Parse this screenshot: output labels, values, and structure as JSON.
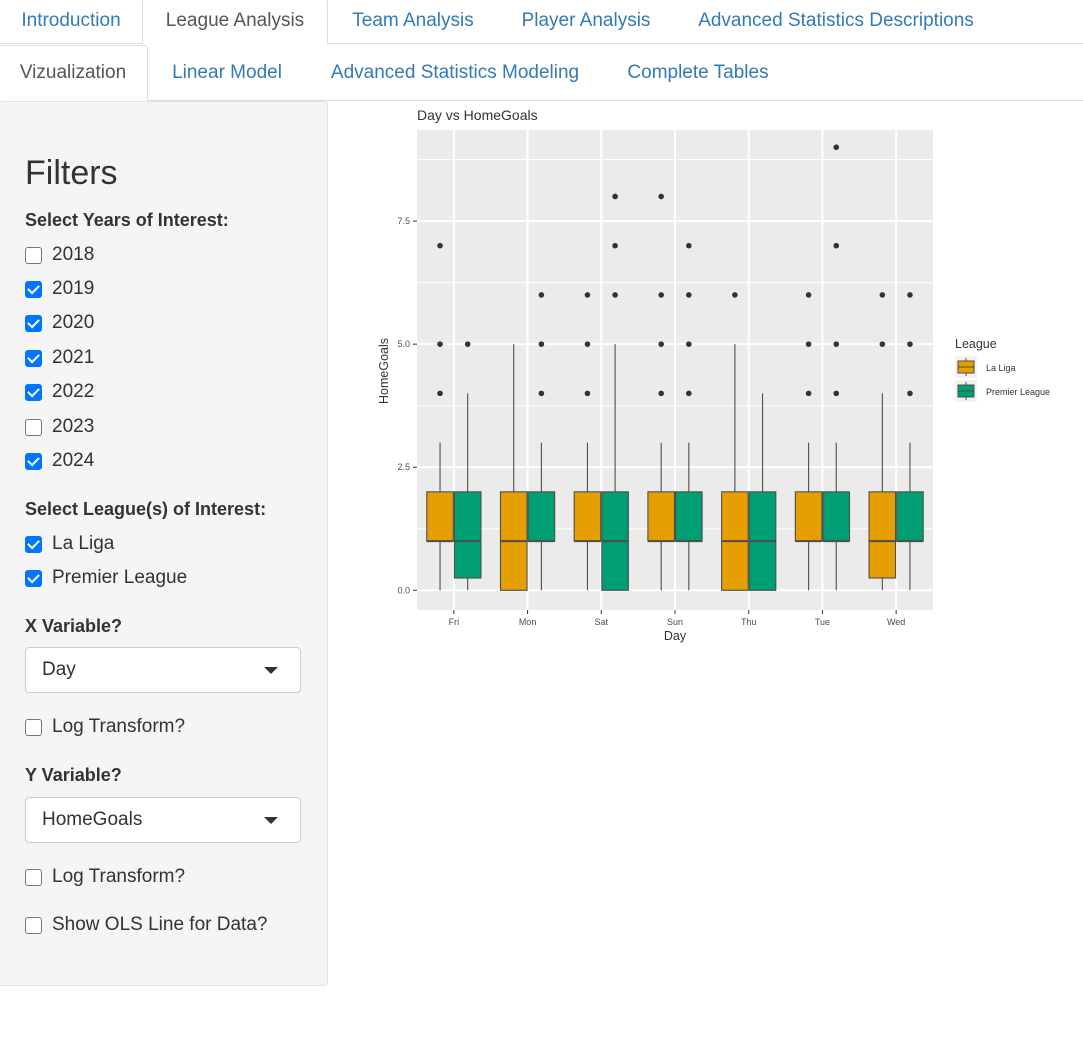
{
  "tabs_primary": [
    {
      "label": "Introduction",
      "active": false
    },
    {
      "label": "League Analysis",
      "active": true
    },
    {
      "label": "Team Analysis",
      "active": false
    },
    {
      "label": "Player Analysis",
      "active": false
    },
    {
      "label": "Advanced Statistics Descriptions",
      "active": false
    }
  ],
  "tabs_secondary": [
    {
      "label": "Vizualization",
      "active": true
    },
    {
      "label": "Linear Model",
      "active": false
    },
    {
      "label": "Advanced Statistics Modeling",
      "active": false
    },
    {
      "label": "Complete Tables",
      "active": false
    }
  ],
  "sidebar": {
    "title": "Filters",
    "years_label": "Select Years of Interest:",
    "years": [
      {
        "label": "2018",
        "checked": false
      },
      {
        "label": "2019",
        "checked": true
      },
      {
        "label": "2020",
        "checked": true
      },
      {
        "label": "2021",
        "checked": true
      },
      {
        "label": "2022",
        "checked": true
      },
      {
        "label": "2023",
        "checked": false
      },
      {
        "label": "2024",
        "checked": true
      }
    ],
    "league_label": "Select League(s) of Interest:",
    "leagues": [
      {
        "label": "La Liga",
        "checked": true
      },
      {
        "label": "Premier League",
        "checked": true
      }
    ],
    "x_label": "X Variable?",
    "x_value": "Day",
    "x_log_label": "Log Transform?",
    "x_log_checked": false,
    "y_label": "Y Variable?",
    "y_value": "HomeGoals",
    "y_log_label": "Log Transform?",
    "y_log_checked": false,
    "ols_label": "Show OLS Line for Data?",
    "ols_checked": false
  },
  "colors": {
    "la_liga": "#E69F00",
    "premier_league": "#009E73",
    "panel_bg": "#EBEBEB",
    "link": "#337ab7"
  },
  "chart_data": {
    "type": "boxplot",
    "title": "Day vs HomeGoals",
    "xlabel": "Day",
    "ylabel": "HomeGoals",
    "ylim": [
      -0.4,
      9.35
    ],
    "yticks": [
      0.0,
      2.5,
      5.0,
      7.5
    ],
    "ytick_labels": [
      "0.0",
      "2.5",
      "5.0",
      "7.5"
    ],
    "categories": [
      "Fri",
      "Mon",
      "Sat",
      "Sun",
      "Thu",
      "Tue",
      "Wed"
    ],
    "grid": true,
    "legend": {
      "title": "League",
      "position": "right"
    },
    "series": [
      {
        "name": "La Liga",
        "color": "#E69F00",
        "boxes": [
          {
            "min": 0,
            "q1": 1,
            "median": 1,
            "q3": 2,
            "max": 3,
            "outliers": [
              4,
              5,
              7
            ]
          },
          {
            "min": 0,
            "q1": 0,
            "median": 1,
            "q3": 2,
            "max": 5,
            "outliers": []
          },
          {
            "min": 0,
            "q1": 1,
            "median": 1,
            "q3": 2,
            "max": 3,
            "outliers": [
              4,
              5,
              6
            ]
          },
          {
            "min": 0,
            "q1": 1,
            "median": 1,
            "q3": 2,
            "max": 3,
            "outliers": [
              4,
              5,
              6,
              8
            ]
          },
          {
            "min": 0,
            "q1": 0,
            "median": 1,
            "q3": 2,
            "max": 5,
            "outliers": [
              6
            ]
          },
          {
            "min": 0,
            "q1": 1,
            "median": 1,
            "q3": 2,
            "max": 3,
            "outliers": [
              4,
              5,
              6
            ]
          },
          {
            "min": 0,
            "q1": 0.25,
            "median": 1,
            "q3": 2,
            "max": 4,
            "outliers": [
              5,
              6
            ]
          }
        ]
      },
      {
        "name": "Premier League",
        "color": "#009E73",
        "boxes": [
          {
            "min": 0,
            "q1": 0.25,
            "median": 1,
            "q3": 2,
            "max": 4,
            "outliers": [
              5
            ]
          },
          {
            "min": 0,
            "q1": 1,
            "median": 1,
            "q3": 2,
            "max": 3,
            "outliers": [
              4,
              5,
              6
            ]
          },
          {
            "min": 0,
            "q1": 0,
            "median": 1,
            "q3": 2,
            "max": 5,
            "outliers": [
              6,
              7,
              8
            ]
          },
          {
            "min": 0,
            "q1": 1,
            "median": 1,
            "q3": 2,
            "max": 3,
            "outliers": [
              4,
              5,
              6,
              7
            ]
          },
          {
            "min": 0,
            "q1": 0,
            "median": 1,
            "q3": 2,
            "max": 4,
            "outliers": []
          },
          {
            "min": 0,
            "q1": 1,
            "median": 1,
            "q3": 2,
            "max": 3,
            "outliers": [
              4,
              5,
              7,
              9
            ]
          },
          {
            "min": 0,
            "q1": 1,
            "median": 1,
            "q3": 2,
            "max": 3,
            "outliers": [
              4,
              5,
              6
            ]
          }
        ]
      }
    ]
  }
}
